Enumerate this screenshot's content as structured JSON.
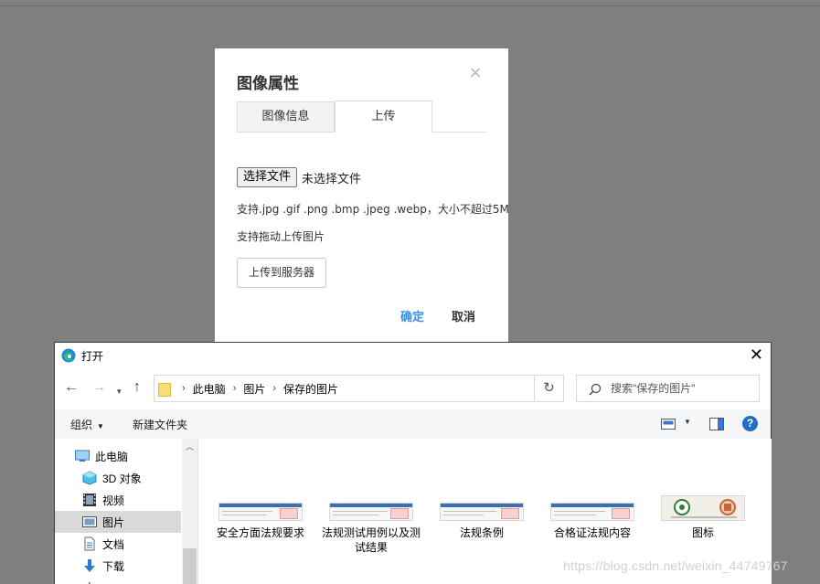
{
  "image_dialog": {
    "title": "图像属性",
    "tabs": [
      {
        "label": "图像信息",
        "active": false
      },
      {
        "label": "上传",
        "active": true
      }
    ],
    "choose_file_label": "选择文件",
    "file_status": "未选择文件",
    "hint_formats": "支持.jpg .gif .png .bmp .jpeg .webp，大小不超过5M",
    "hint_drag": "支持拖动上传图片",
    "upload_button": "上传到服务器",
    "ok_button": "确定",
    "cancel_button": "取消",
    "accent_color": "#3a8ee6"
  },
  "open_dialog": {
    "title": "打开",
    "breadcrumb": [
      "此电脑",
      "图片",
      "保存的图片"
    ],
    "search_placeholder": "搜索\"保存的图片\"",
    "toolbar": {
      "organize": "组织",
      "new_folder": "新建文件夹"
    },
    "sidebar": [
      {
        "label": "此电脑",
        "icon": "computer-icon",
        "selected": false
      },
      {
        "label": "3D 对象",
        "icon": "cube-3d-icon",
        "selected": false
      },
      {
        "label": "视频",
        "icon": "video-icon",
        "selected": false
      },
      {
        "label": "图片",
        "icon": "pictures-icon",
        "selected": true
      },
      {
        "label": "文档",
        "icon": "document-icon",
        "selected": false
      },
      {
        "label": "下载",
        "icon": "download-icon",
        "selected": false
      }
    ],
    "files": [
      {
        "label": "安全方面法规要求"
      },
      {
        "label": "法规测试用例以及测试结果"
      },
      {
        "label": "法规条例"
      },
      {
        "label": "合格证法规内容"
      },
      {
        "label": "图标"
      }
    ]
  },
  "watermark": "https://blog.csdn.net/weixin_44749767"
}
